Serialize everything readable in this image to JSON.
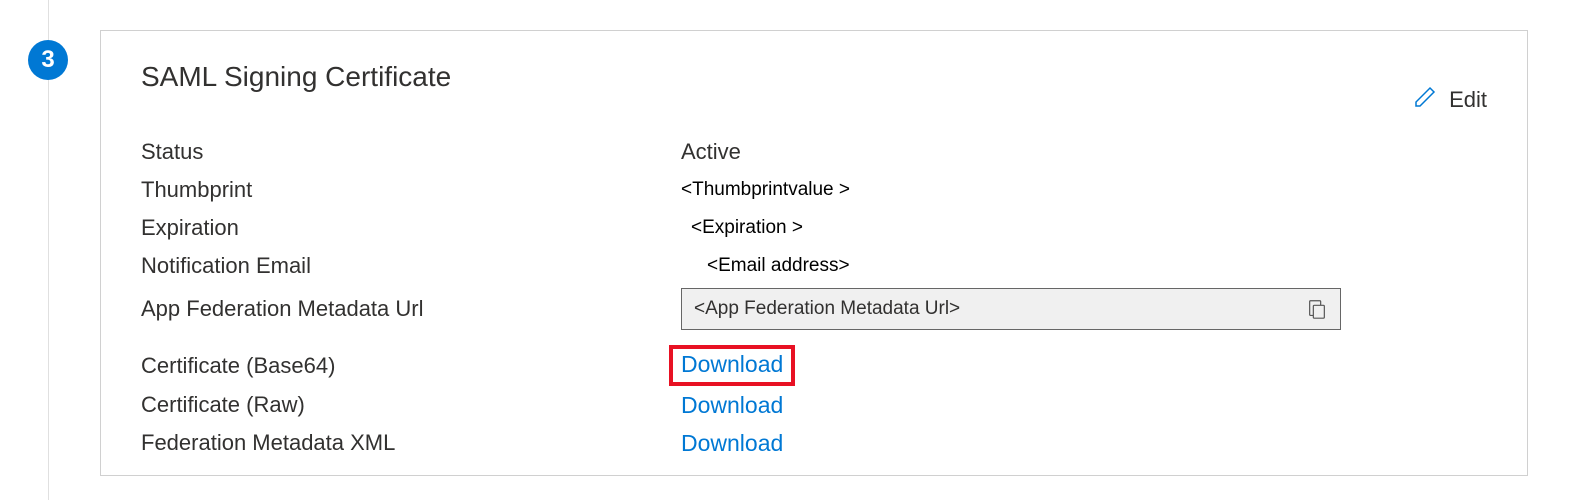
{
  "step": {
    "number": "3"
  },
  "card": {
    "title": "SAML Signing Certificate",
    "edit_label": "Edit",
    "fields": {
      "status": {
        "label": "Status",
        "value": "Active"
      },
      "thumbprint": {
        "label": "Thumbprint",
        "value": "<Thumbprintvalue >"
      },
      "expiration": {
        "label": "Expiration",
        "value": "<Expiration >"
      },
      "notification_email": {
        "label": "Notification Email",
        "value": "<Email address>"
      },
      "metadata_url": {
        "label": "App Federation Metadata Url",
        "value": "<App Federation Metadata Url>"
      },
      "cert_base64": {
        "label": "Certificate (Base64)",
        "action": "Download"
      },
      "cert_raw": {
        "label": "Certificate (Raw)",
        "action": "Download"
      },
      "fed_metadata_xml": {
        "label": "Federation Metadata XML",
        "action": "Download"
      }
    }
  }
}
